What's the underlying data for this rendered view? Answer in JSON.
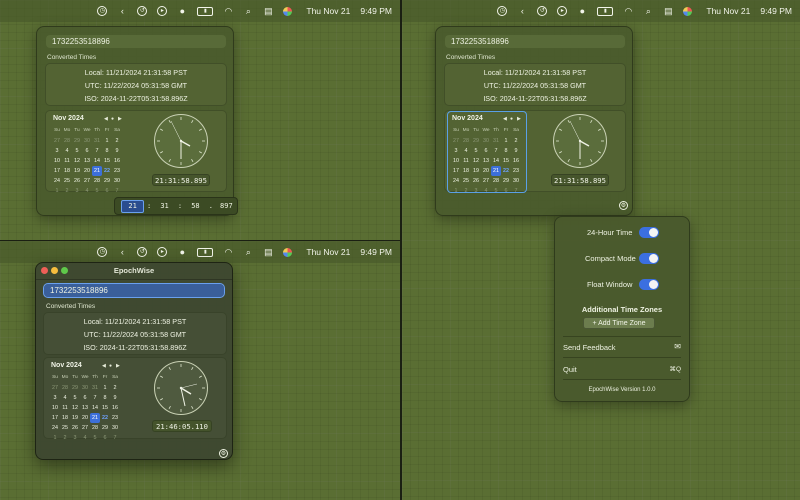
{
  "menubar": {
    "date": "Thu Nov 21",
    "time": "9:49 PM"
  },
  "epoch": {
    "value": "1732253518896"
  },
  "converted": {
    "label": "Converted Times",
    "local": "Local: 11/21/2024 21:31:58 PST",
    "utc": "UTC: 11/22/2024 05:31:58 GMT",
    "iso": "ISO: 2024-11-22T05:31:58.896Z"
  },
  "calendar": {
    "title": "Nov 2024",
    "nav_prev": "◀",
    "nav_today": "●",
    "nav_next": "▶",
    "weekdays": [
      "Su",
      "Mo",
      "Tu",
      "We",
      "Th",
      "Fr",
      "Sa"
    ],
    "rows": [
      [
        "27",
        "28",
        "29",
        "30",
        "31",
        "1",
        "2"
      ],
      [
        "3",
        "4",
        "5",
        "6",
        "7",
        "8",
        "9"
      ],
      [
        "10",
        "11",
        "12",
        "13",
        "14",
        "15",
        "16"
      ],
      [
        "17",
        "18",
        "19",
        "20",
        "21",
        "22",
        "23"
      ],
      [
        "24",
        "25",
        "26",
        "27",
        "28",
        "29",
        "30"
      ],
      [
        "1",
        "2",
        "3",
        "4",
        "5",
        "6",
        "7"
      ]
    ]
  },
  "time_display": {
    "popover": "21:31:58.895",
    "window": "21:46:05.110"
  },
  "time_stepper": {
    "hour": "21",
    "minute": "31",
    "second": "58",
    "millis": "897",
    "sep_colon": ":",
    "sep_dot": "."
  },
  "window": {
    "title": "EpochWise"
  },
  "settings": {
    "hour24_label": "24-Hour Time",
    "compact_label": "Compact Mode",
    "float_label": "Float Window",
    "additional_zones_label": "Additional Time Zones",
    "add_zone_button": "+ Add Time Zone",
    "feedback_label": "Send Feedback",
    "quit_label": "Quit",
    "quit_shortcut": "⌘Q",
    "version": "EpochWise Version 1.0.0"
  },
  "colors": {
    "accent": "#3b6fe0",
    "today": "#6fa3ff",
    "panel": "#4a5a2d"
  }
}
